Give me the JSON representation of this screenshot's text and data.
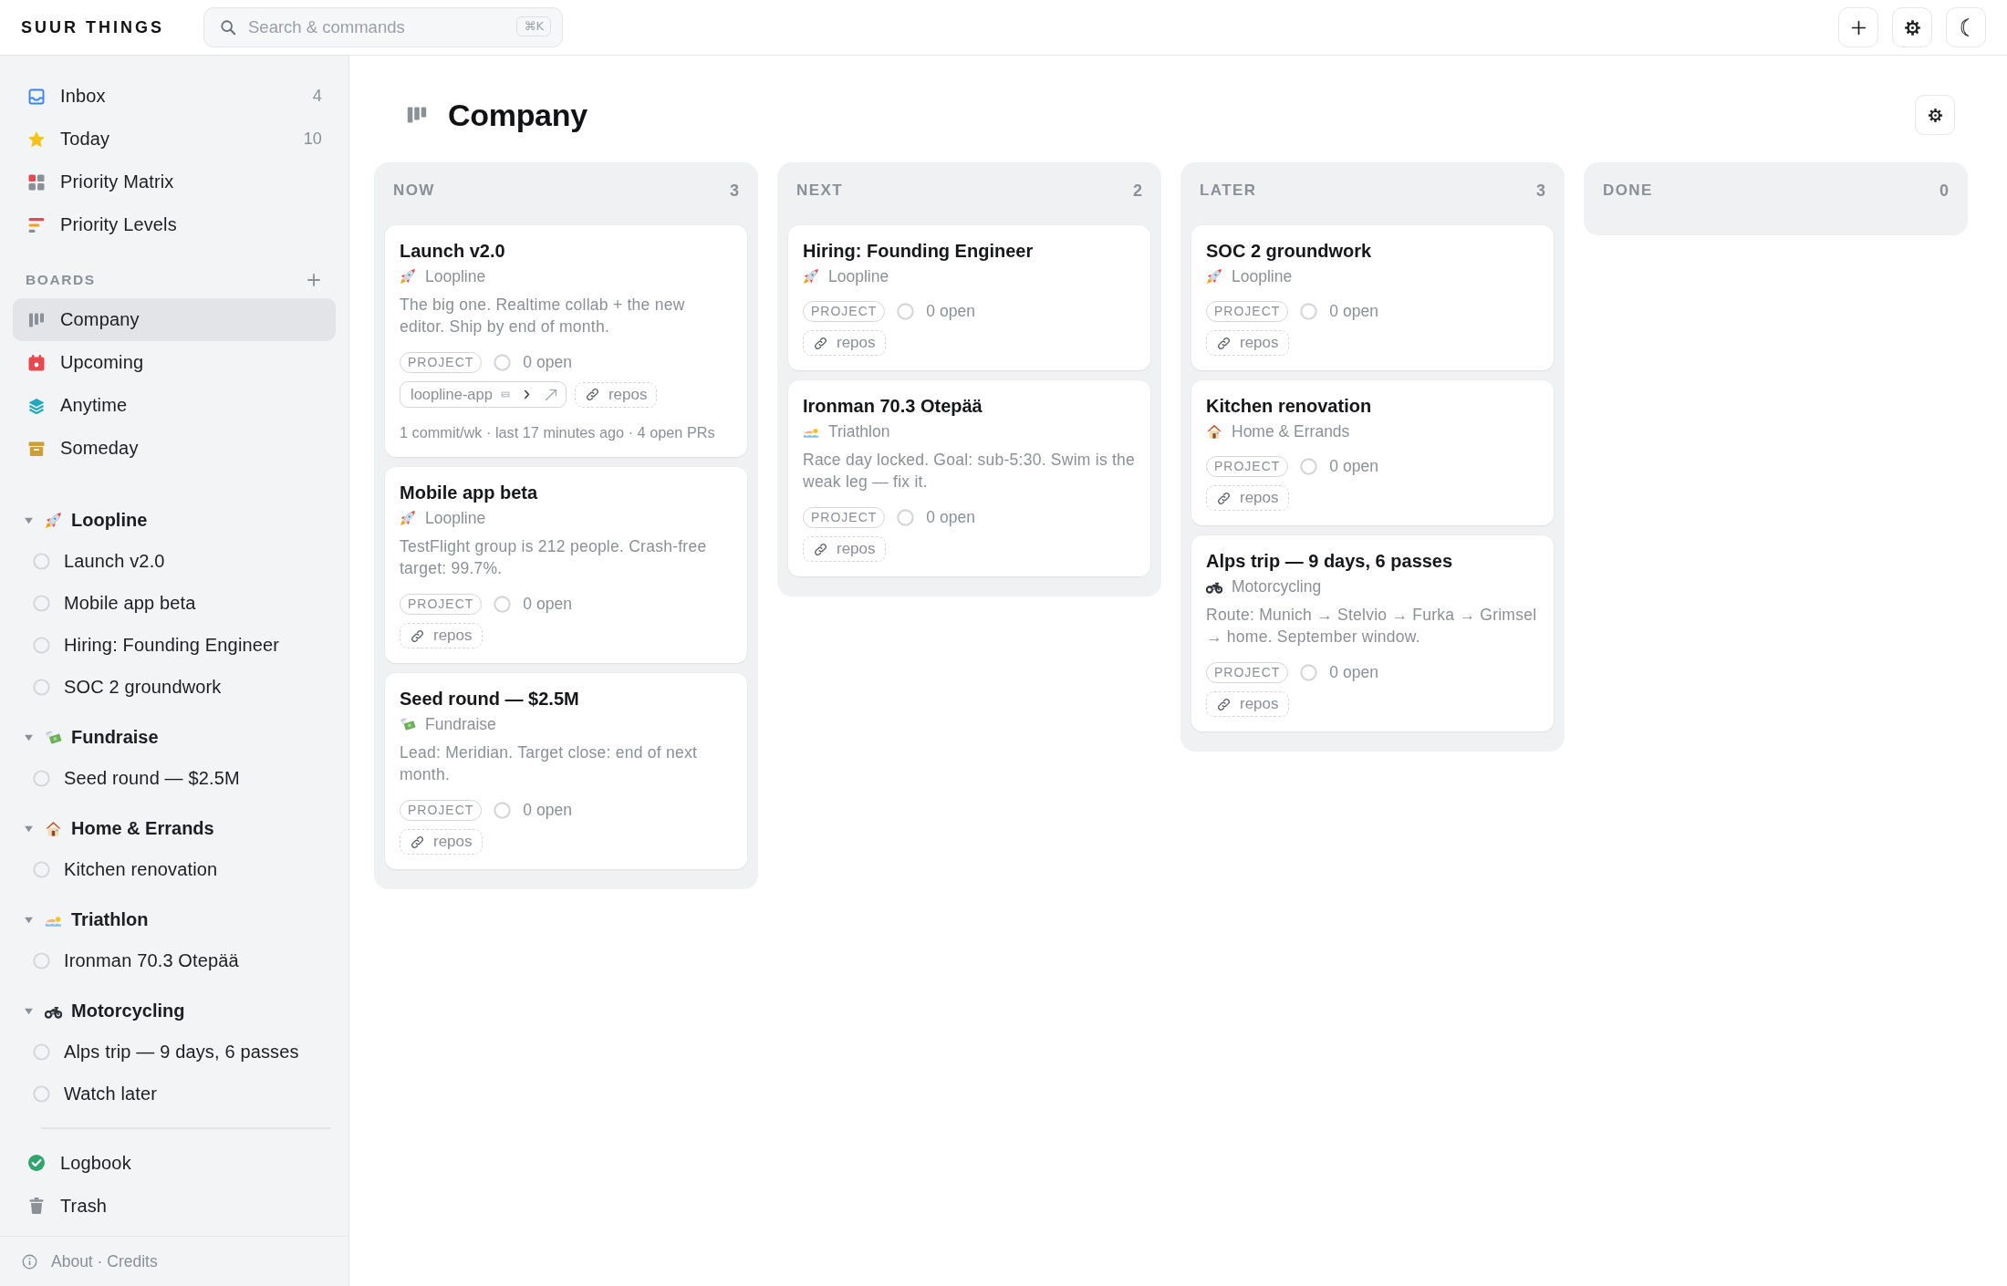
{
  "app": {
    "name": "SUUR THINGS"
  },
  "search": {
    "placeholder": "Search & commands",
    "shortcut": "⌘K"
  },
  "sidebar": {
    "nav": [
      {
        "label": "Inbox",
        "kind": "inbox",
        "count": "4",
        "selected": false
      },
      {
        "label": "Today",
        "kind": "star",
        "count": "10",
        "selected": false
      },
      {
        "label": "Priority Matrix",
        "kind": "matrix",
        "selected": false
      },
      {
        "label": "Priority Levels",
        "kind": "levels",
        "selected": false
      }
    ],
    "boards": {
      "title": "BOARDS",
      "items": [
        {
          "label": "Company",
          "kind": "board",
          "selected": true
        },
        {
          "label": "Upcoming",
          "kind": "calendar",
          "selected": false
        },
        {
          "label": "Anytime",
          "kind": "layers",
          "selected": false
        },
        {
          "label": "Someday",
          "kind": "archive",
          "selected": false
        }
      ]
    },
    "areas": [
      {
        "name": "Loopline",
        "kind": "rocket",
        "expanded": true,
        "children": [
          {
            "label": "Launch v2.0",
            "checked": false
          },
          {
            "label": "Mobile app beta",
            "checked": false
          },
          {
            "label": "Hiring: Founding Engineer",
            "checked": false
          },
          {
            "label": "SOC 2 groundwork",
            "checked": false
          }
        ]
      },
      {
        "name": "Fundraise",
        "kind": "money",
        "expanded": true,
        "children": [
          {
            "label": "Seed round — $2.5M",
            "checked": false
          }
        ]
      },
      {
        "name": "Home & Errands",
        "kind": "house",
        "expanded": true,
        "children": [
          {
            "label": "Kitchen renovation",
            "checked": false
          }
        ]
      },
      {
        "name": "Triathlon",
        "kind": "swimmer",
        "expanded": true,
        "children": [
          {
            "label": "Ironman 70.3 Otepää",
            "checked": false
          }
        ]
      },
      {
        "name": "Motorcycling",
        "kind": "motorcycle",
        "expanded": true,
        "children": [
          {
            "label": "Alps trip — 9 days, 6 passes",
            "checked": false
          },
          {
            "label": "Watch later",
            "checked": false
          }
        ]
      }
    ],
    "footer_nav": [
      {
        "label": "Logbook",
        "kind": "check",
        "selected": false
      },
      {
        "label": "Trash",
        "kind": "trash",
        "selected": false
      }
    ],
    "about": "About · Credits"
  },
  "board": {
    "title": "Company",
    "columns": [
      {
        "name": "NOW",
        "count": "3",
        "cards": [
          {
            "title": "Launch v2.0",
            "area": {
              "name": "Loopline",
              "kind": "rocket"
            },
            "description": "The big one. Realtime collab + the new editor. Ship by end of month.",
            "tag": "PROJECT",
            "open": "0 open",
            "repo": "loopline-app",
            "link": "repos",
            "stats": "1 commit/wk · last 17 minutes ago · 4 open PRs"
          },
          {
            "title": "Mobile app beta",
            "area": {
              "name": "Loopline",
              "kind": "rocket"
            },
            "description": "TestFlight group is 212 people. Crash-free target: 99.7%.",
            "tag": "PROJECT",
            "open": "0 open",
            "link": "repos"
          },
          {
            "title": "Seed round — $2.5M",
            "area": {
              "name": "Fundraise",
              "kind": "money"
            },
            "description": "Lead: Meridian. Target close: end of next month.",
            "tag": "PROJECT",
            "open": "0 open",
            "link": "repos"
          }
        ]
      },
      {
        "name": "NEXT",
        "count": "2",
        "cards": [
          {
            "title": "Hiring: Founding Engineer",
            "area": {
              "name": "Loopline",
              "kind": "rocket"
            },
            "tag": "PROJECT",
            "open": "0 open",
            "link": "repos"
          },
          {
            "title": "Ironman 70.3 Otepää",
            "area": {
              "name": "Triathlon",
              "kind": "swimmer"
            },
            "description": "Race day locked. Goal: sub-5:30. Swim is the weak leg — fix it.",
            "tag": "PROJECT",
            "open": "0 open",
            "link": "repos"
          }
        ]
      },
      {
        "name": "LATER",
        "count": "3",
        "cards": [
          {
            "title": "SOC 2 groundwork",
            "area": {
              "name": "Loopline",
              "kind": "rocket"
            },
            "tag": "PROJECT",
            "open": "0 open",
            "link": "repos"
          },
          {
            "title": "Kitchen renovation",
            "area": {
              "name": "Home & Errands",
              "kind": "house"
            },
            "tag": "PROJECT",
            "open": "0 open",
            "link": "repos"
          },
          {
            "title": "Alps trip — 9 days, 6 passes",
            "area": {
              "name": "Motorcycling",
              "kind": "motorcycle"
            },
            "description": "Route: Munich → Stelvio → Furka → Grimsel → home. September window.",
            "tag": "PROJECT",
            "open": "0 open",
            "link": "repos"
          }
        ]
      },
      {
        "name": "DONE",
        "count": "0"
      }
    ]
  }
}
